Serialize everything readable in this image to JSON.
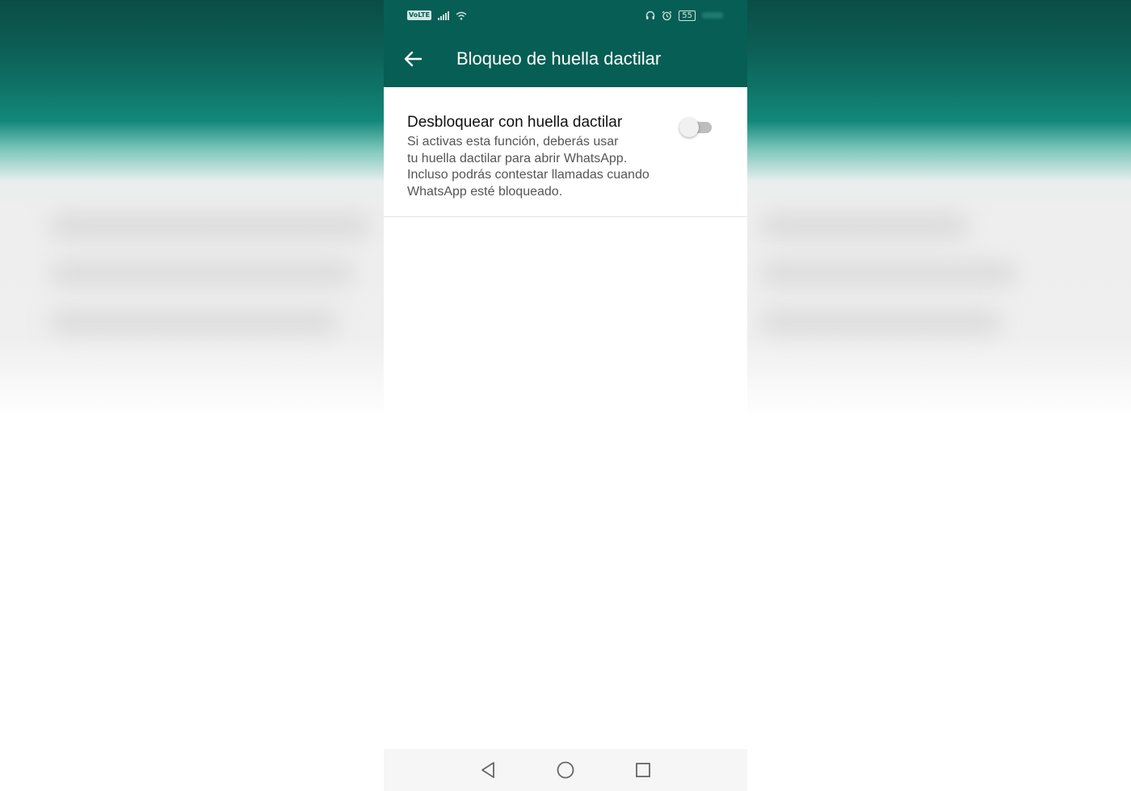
{
  "status_bar": {
    "network_badge": "VoLTE",
    "battery_level": "55",
    "icons": [
      "signal-icon",
      "wifi-icon",
      "headphones-icon",
      "alarm-icon",
      "battery-icon"
    ]
  },
  "app_bar": {
    "title": "Bloqueo de huella dactilar",
    "back_icon": "arrow-left-icon"
  },
  "setting": {
    "title": "Desbloquear con huella dactilar",
    "description_lines": [
      "Si activas esta función, deberás usar",
      "tu huella dactilar para abrir WhatsApp.",
      "Incluso podrás contestar llamadas cuando",
      "WhatsApp esté bloqueado."
    ],
    "enabled": false
  },
  "nav_bar": {
    "icons": [
      "nav-back-icon",
      "nav-home-icon",
      "nav-recents-icon"
    ]
  },
  "colors": {
    "primary_dark": "#075e54",
    "toggle_off_track": "#bdbdbd",
    "toggle_off_thumb": "#f1f1f1"
  }
}
